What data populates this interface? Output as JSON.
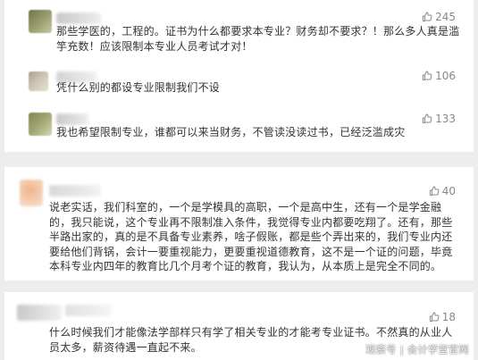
{
  "colors": {
    "page_background": "#ededed",
    "card_background": "#ffffff",
    "comment_text": "#333333",
    "like_text": "#888888",
    "avatar_olive": "#8c8f5c",
    "avatar_peach": "#f2c6a6"
  },
  "icons": {
    "like": "thumbs-up-outline-icon"
  },
  "comments": [
    {
      "text": "那些学医的，工程的。证书为什么都要求本专业？财务却不要求？！那么多人真是滥竽充数！应该限制本专业人员考试才对！",
      "likes": "245"
    },
    {
      "text": "凭什么别的都设专业限制我们不设",
      "likes": "106"
    },
    {
      "text": "我也希望限制专业，谁都可以来当财务，不管读没读过书，已经泛滥成灾",
      "likes": "133"
    },
    {
      "text": "说老实话，我们科室的，一个是学模具的高职，一个是高中生，还有一个是学金融的，我只能说，这个专业再不限制准入条件，我觉得专业内都要吃翔了。还有，那些半路出家的，真的是不具备专业素养，啥子假账，都是些个弄出来的，我们专业内还要给他们背锅，会计一要重视能力，更要重视道德教育，这不是一个证的问题，毕竟本科专业内四年的教育比几个月考个证的教育，我认为，从本质上是完全不同的。",
      "likes": "40"
    },
    {
      "text": "什么时候我们才能像法学部样只有学了相关专业的才能考专业证书。不然真的从业人员太多，薪资待遇一直起不来。",
      "likes": "18"
    }
  ],
  "watermark": "观察号 | 会计学堂官网"
}
